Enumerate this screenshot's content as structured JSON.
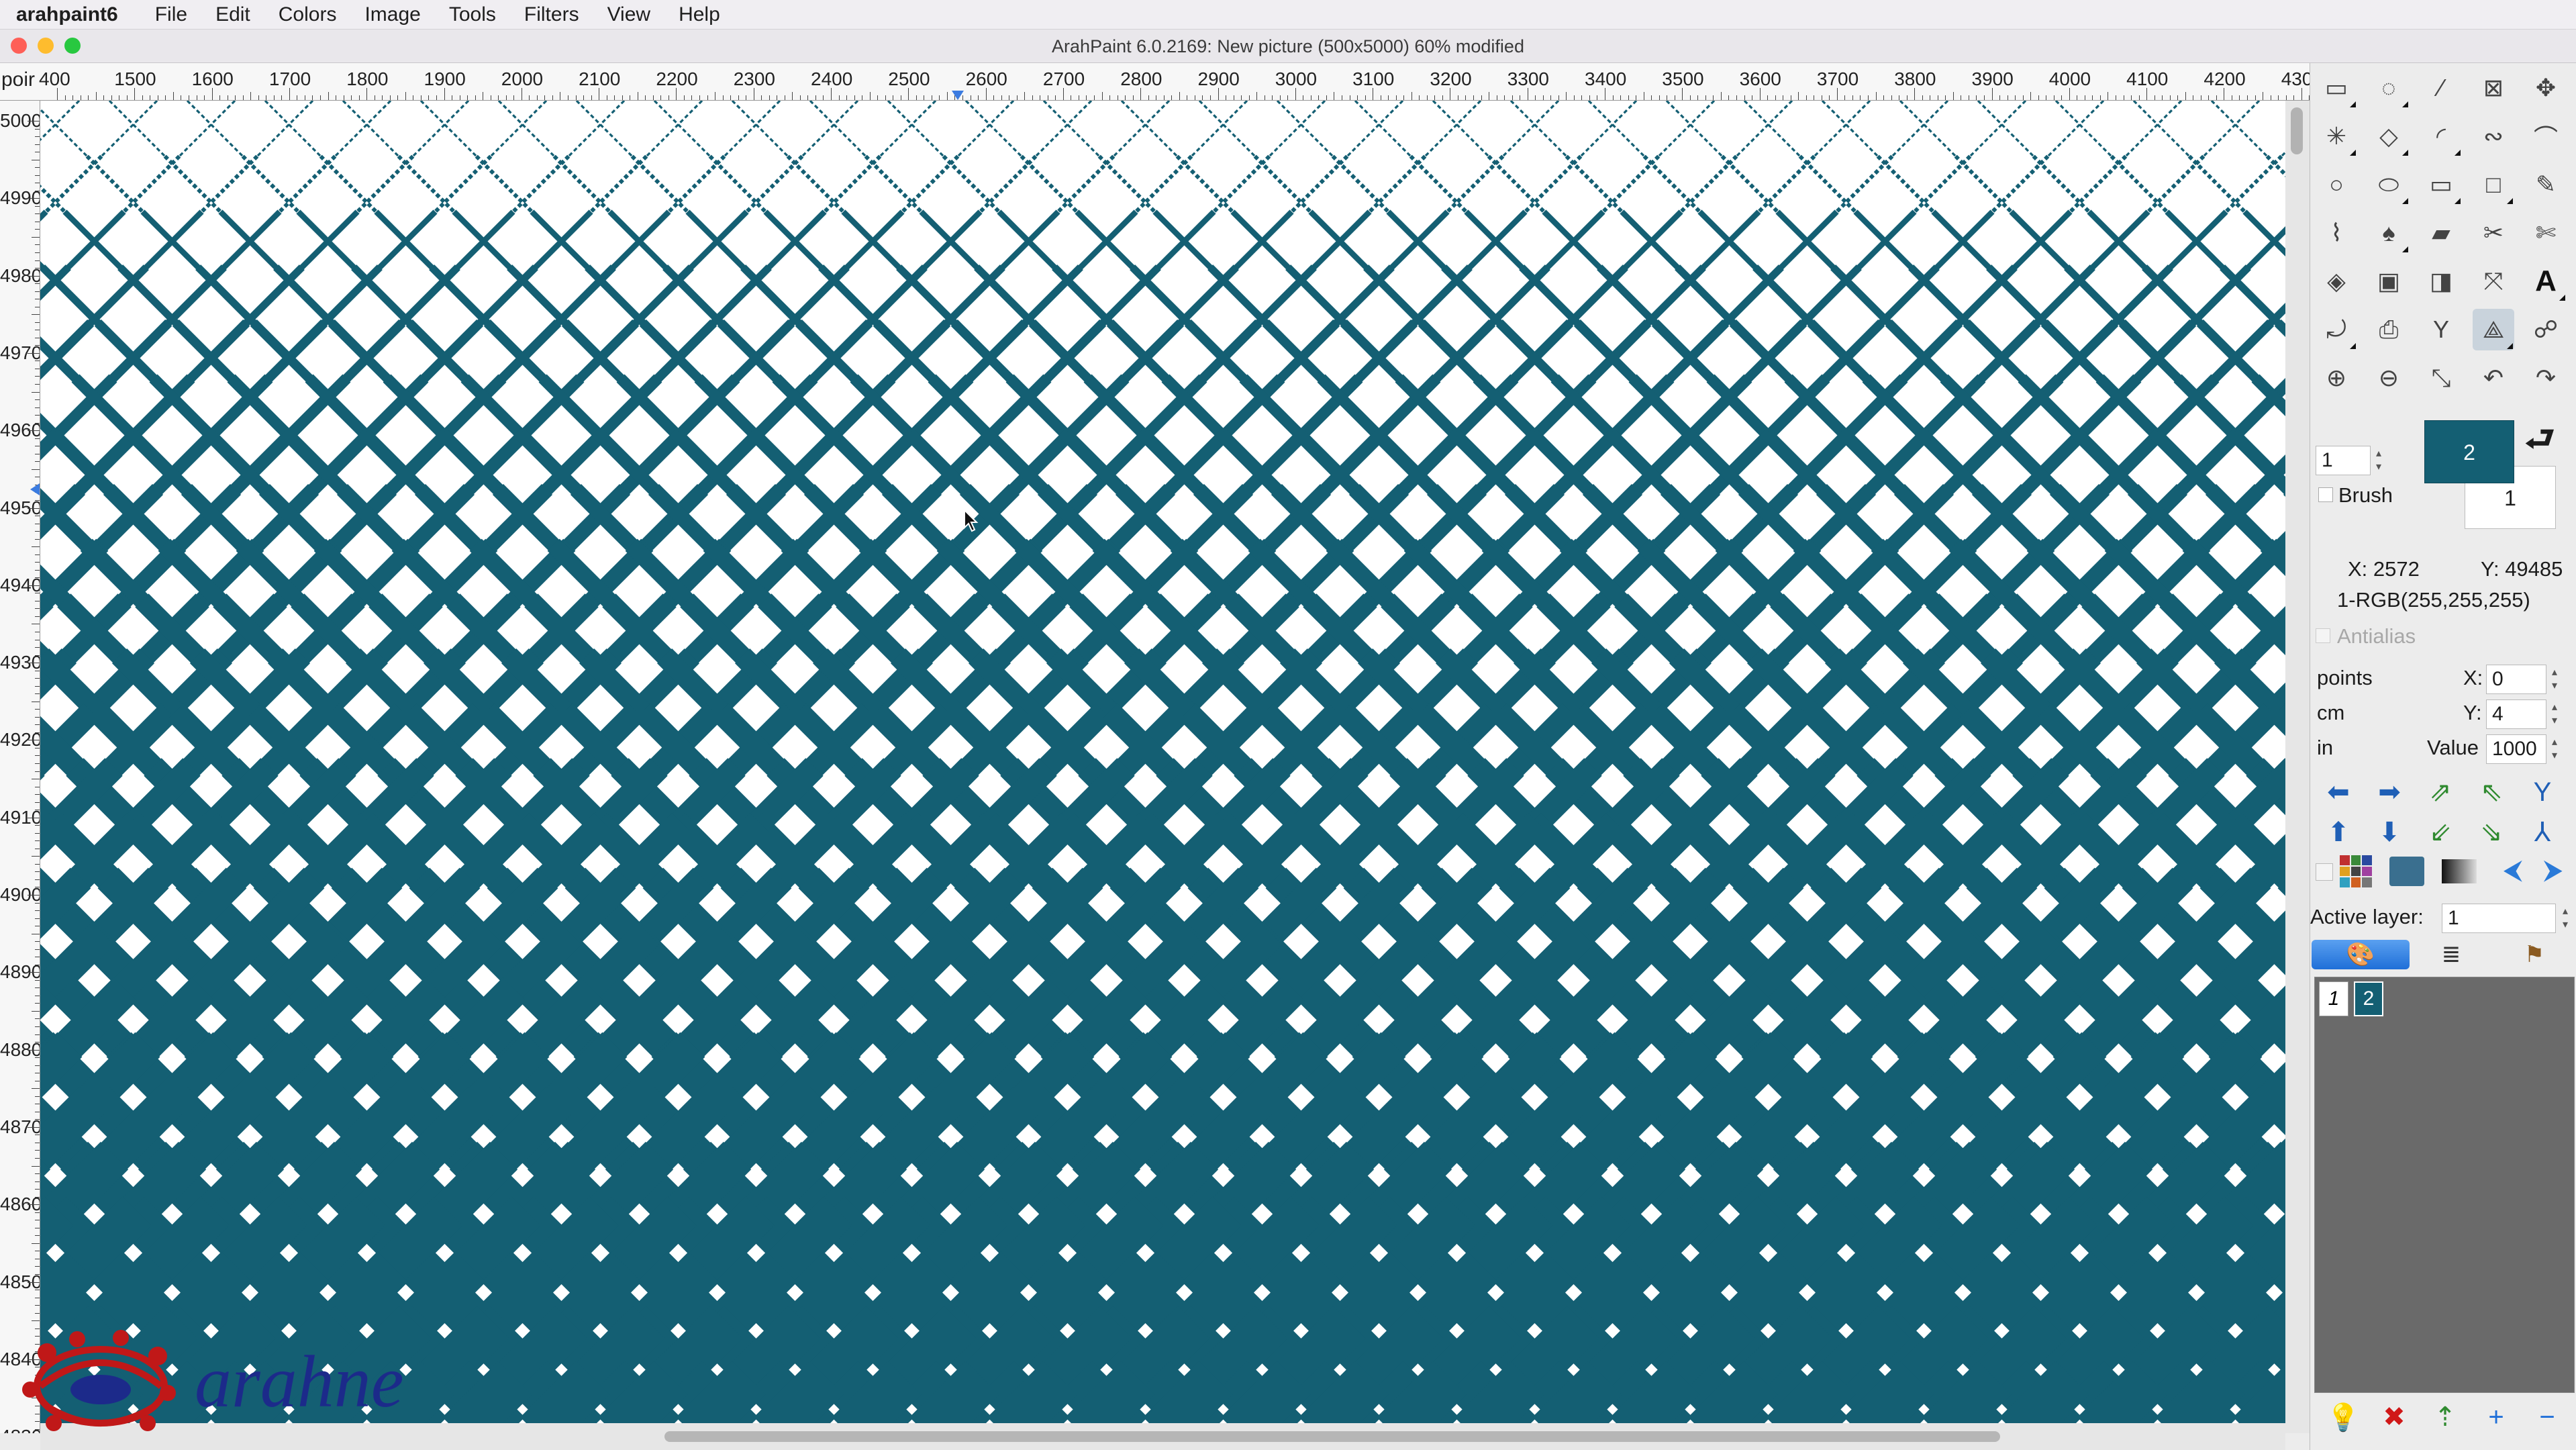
{
  "menubar": {
    "app": "arahpaint6",
    "items": [
      "File",
      "Edit",
      "Colors",
      "Image",
      "Tools",
      "Filters",
      "View",
      "Help"
    ]
  },
  "window": {
    "title": "ArahPaint 6.0.2169: New picture  (500x5000) 60% modified"
  },
  "ruler": {
    "unit_label": "poir",
    "top_ticks": [
      "400",
      "1500",
      "1600",
      "1700",
      "1800",
      "1900",
      "2000",
      "2100",
      "2200",
      "2300",
      "2400",
      "2500",
      "2600",
      "2700",
      "2800",
      "2900",
      "3000",
      "3100",
      "3200",
      "3300",
      "3400",
      "3500",
      "3600",
      "3700",
      "3800",
      "3900",
      "4000",
      "4100",
      "4200",
      "430"
    ],
    "left_ticks": [
      "5000",
      "4990",
      "4980",
      "4970",
      "4960",
      "4950",
      "4940",
      "4930",
      "4920",
      "4910",
      "4900",
      "4890",
      "4880",
      "4870",
      "4860",
      "4850",
      "4840",
      "4830"
    ]
  },
  "canvas": {
    "fill_color": "#145f73",
    "background": "#ffffff"
  },
  "tools": [
    {
      "name": "select-rect-icon",
      "glyph": "▭"
    },
    {
      "name": "lasso-icon",
      "glyph": "◌"
    },
    {
      "name": "magic-wand-icon",
      "glyph": "⁄"
    },
    {
      "name": "crop-icon",
      "glyph": "⊠"
    },
    {
      "name": "move-icon",
      "glyph": "✥"
    },
    {
      "name": "star-wand-icon",
      "glyph": "✳"
    },
    {
      "name": "polygon-icon",
      "glyph": "◇"
    },
    {
      "name": "curve-icon",
      "glyph": "◜"
    },
    {
      "name": "bezier-icon",
      "glyph": "∾"
    },
    {
      "name": "path-icon",
      "glyph": "⌒"
    },
    {
      "name": "circle-icon",
      "glyph": "○"
    },
    {
      "name": "ellipse-icon",
      "glyph": "⬭"
    },
    {
      "name": "rectangle-icon",
      "glyph": "▭"
    },
    {
      "name": "square-icon",
      "glyph": "□"
    },
    {
      "name": "pencil-icon",
      "glyph": "✎"
    },
    {
      "name": "eyedropper-icon",
      "glyph": "⌇"
    },
    {
      "name": "brush-icon",
      "glyph": "♠"
    },
    {
      "name": "eraser-icon",
      "glyph": "▰"
    },
    {
      "name": "cut-icon",
      "glyph": "✂"
    },
    {
      "name": "scissors-icon",
      "glyph": "✄"
    },
    {
      "name": "fill-icon",
      "glyph": "◈"
    },
    {
      "name": "stamp-icon",
      "glyph": "▣"
    },
    {
      "name": "copy-icon",
      "glyph": "◨"
    },
    {
      "name": "transform-icon",
      "glyph": "⤧"
    },
    {
      "name": "text-icon",
      "glyph": "A"
    },
    {
      "name": "rotate-icon",
      "glyph": "⤾"
    },
    {
      "name": "print-icon",
      "glyph": "⎙"
    },
    {
      "name": "gradient-icon",
      "glyph": "Y"
    },
    {
      "name": "sharpen-icon",
      "glyph": "⟁"
    },
    {
      "name": "smudge-icon",
      "glyph": "☍"
    },
    {
      "name": "zoom-in-icon",
      "glyph": "⊕"
    },
    {
      "name": "zoom-out-icon",
      "glyph": "⊖"
    },
    {
      "name": "fit-icon",
      "glyph": "⤡"
    },
    {
      "name": "undo-icon",
      "glyph": "↶"
    },
    {
      "name": "redo-icon",
      "glyph": "↷"
    }
  ],
  "brush": {
    "size": "1",
    "label": "Brush",
    "fg_color_label": "2",
    "bg_color_label": "1",
    "fg_color": "#145f73",
    "bg_color": "#ffffff"
  },
  "status": {
    "x": "X: 2572",
    "y": "Y: 49485",
    "color": "1-RGB(255,255,255)"
  },
  "options": {
    "antialias": "Antialias",
    "units": [
      "points",
      "cm",
      "in"
    ],
    "x_label": "X:",
    "x_value": "0",
    "y_label": "Y:",
    "y_value": "4",
    "value_label": "Value",
    "value_value": "1000"
  },
  "shift_buttons": [
    {
      "name": "arrow-left-icon",
      "glyph": "⬅"
    },
    {
      "name": "arrow-right-icon",
      "glyph": "➡"
    },
    {
      "name": "shift-diag-up-icon",
      "glyph": "⇗"
    },
    {
      "name": "shift-diag-down-icon",
      "glyph": "⇖"
    },
    {
      "name": "mirror-v-icon",
      "glyph": "Y"
    },
    {
      "name": "arrow-up-icon",
      "glyph": "⬆"
    },
    {
      "name": "arrow-down-icon",
      "glyph": "⬇"
    },
    {
      "name": "shift-diag-left-icon",
      "glyph": "⇙"
    },
    {
      "name": "shift-diag-right-icon",
      "glyph": "⇘"
    },
    {
      "name": "mirror-h-icon",
      "glyph": "⅄"
    }
  ],
  "layers": {
    "active_label": "Active layer:",
    "active_value": "1",
    "tabs": [
      "palette-tab-icon",
      "layers-tab-icon",
      "stamp-tab-icon"
    ],
    "items": [
      "1",
      "2"
    ]
  },
  "layer_buttons": [
    {
      "name": "light-bulb-icon",
      "glyph": "💡"
    },
    {
      "name": "delete-layer-icon",
      "glyph": "✖"
    },
    {
      "name": "merge-layer-icon",
      "glyph": "⇡"
    },
    {
      "name": "add-layer-icon",
      "glyph": "+"
    },
    {
      "name": "remove-layer-icon",
      "glyph": "−"
    }
  ],
  "logo": {
    "text": "arahne"
  }
}
